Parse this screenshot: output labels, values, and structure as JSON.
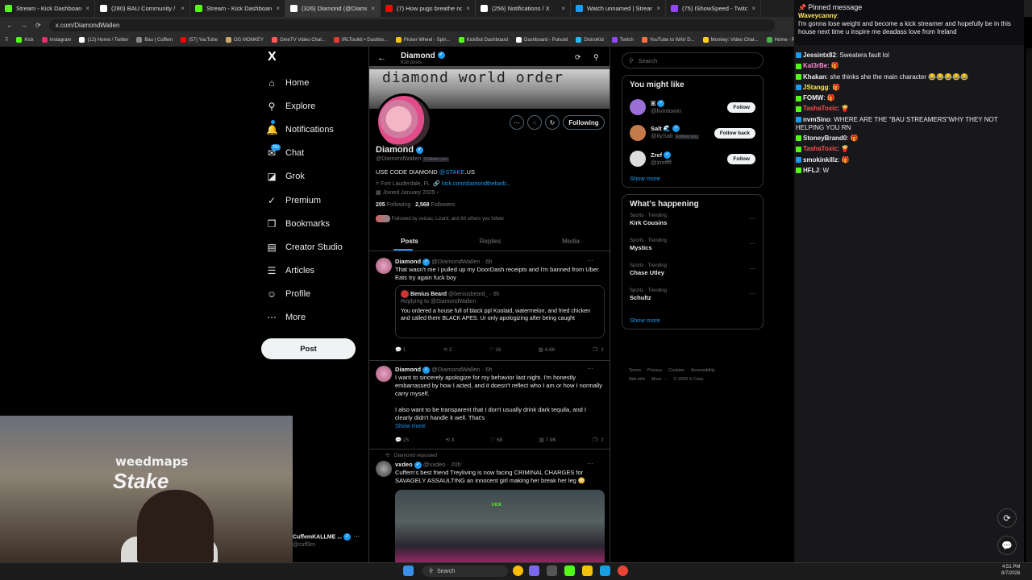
{
  "tabs": [
    {
      "title": "Stream - Kick Dashboard",
      "color": "#53fc18"
    },
    {
      "title": "(280) BAU Community / X",
      "color": "#ffffff"
    },
    {
      "title": "Stream - Kick Dashboard",
      "color": "#53fc18"
    },
    {
      "title": "(326) Diamond (@DiamondWa…",
      "color": "#ffffff"
    },
    {
      "title": "(7) How pugs breathe normally…",
      "color": "#ff0000"
    },
    {
      "title": "(256) Notifications / X",
      "color": "#ffffff"
    },
    {
      "title": "Watch unnamed | Streamable",
      "color": "#1d9bf0"
    },
    {
      "title": "(75) IShowSpeed - Twitch",
      "color": "#9146ff"
    }
  ],
  "address": {
    "url": "x.com/DiamondWallen"
  },
  "bookmarks": [
    {
      "label": "Kick",
      "color": "#53fc18"
    },
    {
      "label": "Instagram",
      "color": "#e1306c"
    },
    {
      "label": "(12) Home / Twitter",
      "color": "#ffffff"
    },
    {
      "label": "Bau | Cuffem",
      "color": "#888888"
    },
    {
      "label": "(57) YouTube",
      "color": "#ff0000"
    },
    {
      "label": "OG MONKEY",
      "color": "#c9a86a"
    },
    {
      "label": "OmeTV Video Chat...",
      "color": "#ff5a5a"
    },
    {
      "label": "IRLToolkit • Dashbo...",
      "color": "#e53935"
    },
    {
      "label": "Picker Wheel - Spin...",
      "color": "#f4c20d"
    },
    {
      "label": "KickBot Dashboard",
      "color": "#53fc18"
    },
    {
      "label": "Dashboard - Pulsoid",
      "color": "#ffffff"
    },
    {
      "label": "DistroKid",
      "color": "#29b6f6"
    },
    {
      "label": "Twitch",
      "color": "#9146ff"
    },
    {
      "label": "YouTube to WAV D...",
      "color": "#ff7043"
    },
    {
      "label": "Monkey: Video Chat...",
      "color": "#ffca28"
    },
    {
      "label": "Home - Rob",
      "color": "#4caf50"
    }
  ],
  "nav": {
    "logo": "X",
    "items": [
      {
        "label": "Home",
        "icon": "⌂"
      },
      {
        "label": "Explore",
        "icon": "⚲"
      },
      {
        "label": "Notifications",
        "icon": "🔔"
      },
      {
        "label": "Chat",
        "icon": "✉"
      },
      {
        "label": "Grok",
        "icon": "◪"
      },
      {
        "label": "Premium",
        "icon": "✓"
      },
      {
        "label": "Bookmarks",
        "icon": "❒"
      },
      {
        "label": "Creator Studio",
        "icon": "▤"
      },
      {
        "label": "Articles",
        "icon": "☰"
      },
      {
        "label": "Profile",
        "icon": "☺"
      },
      {
        "label": "More",
        "icon": "⋯"
      }
    ],
    "chat_badge": "20+",
    "post_label": "Post"
  },
  "profile": {
    "header_name": "Diamond",
    "header_posts": "918 posts",
    "banner_text": "diamond world order",
    "name": "Diamond",
    "handle": "@DiamondWallen",
    "follows_you": "Follows you",
    "bio_prefix": "USE CODE DIAMOND",
    "bio_link": "@STAKE",
    "bio_suffix": ".US",
    "location": "Fort Lauderdale, FL",
    "website": "kick.com/diamondthebarb...",
    "joined": "Joined January 2025",
    "following_count": "205",
    "following_label": "Following",
    "followers_count": "2,568",
    "followers_label": "Followers",
    "followed_by": "Followed by veizau, Lizard, and 60 others you follow",
    "following_btn": "Following"
  },
  "profile_tabs": [
    "Posts",
    "Replies",
    "Media"
  ],
  "tweets": [
    {
      "name": "Diamond",
      "handle": "@DiamondWallen · 6h",
      "text": "That wasn't me I pulled up my DoorDash receipts and I'm banned from Uber Eats try again fuck boy",
      "quote": {
        "name": "Benius Beard",
        "handle": "@beniusbeard_ · 6h",
        "replying": "Replying to @DiamondWallen",
        "text": "You ordered a house full of black ppl Koolaid, watermelon, and fried chicken and called them BLACK APES. Ur only apologizing after being caught"
      },
      "replies": "1",
      "reposts": "2",
      "likes": "16",
      "views": "4.6K"
    },
    {
      "name": "Diamond",
      "handle": "@DiamondWallen · 6h",
      "text": "I want to sincerely apologize for my behavior last night. I'm honestly embarrassed by how I acted, and it doesn't reflect who I am or how I normally carry myself.",
      "text2": "I also want to be transparent that I don't usually drink dark tequila, and I clearly didn't handle it well. That's",
      "show_more": "Show more",
      "replies": "25",
      "reposts": "3",
      "likes": "68",
      "views": "7.9K"
    },
    {
      "repost_label": "Diamond reposted",
      "name": "vxdeo",
      "handle": "@vxdeo · 20h",
      "text": "Cuffem's best friend Treyliving is now facing CRIMINAL CHARGES for SAVAGELY ASSAULTING an innocent girl making her break her leg 😳",
      "media_tag": "KICK"
    }
  ],
  "right": {
    "search_placeholder": "Search",
    "might_like_title": "You might like",
    "suggestions": [
      {
        "name": "ꕤ",
        "handle": "@livintowin",
        "button": "Follow",
        "color": "#9b6fd6"
      },
      {
        "name": "Salt 🌊",
        "handle": "@ilySalt",
        "follows_you": "Follows you",
        "button": "Follow back",
        "color": "#c47a4a"
      },
      {
        "name": "Zref",
        "handle": "@zreffff",
        "button": "Follow",
        "color": "#dddddd"
      }
    ],
    "show_more": "Show more",
    "happening_title": "What's happening",
    "trends": [
      {
        "context": "Sports · Trending",
        "topic": "Kirk Cousins"
      },
      {
        "context": "Sports · Trending",
        "topic": "Mystics"
      },
      {
        "context": "Sports · Trending",
        "topic": "Chase Utley"
      },
      {
        "context": "Sports · Trending",
        "topic": "Schultz"
      }
    ],
    "footer": [
      "Terms",
      "Privacy",
      "Cookies",
      "Accessibility",
      "Ads info",
      "More ···",
      "© 2026 X Corp."
    ]
  },
  "chat": {
    "pinned_title": "Pinned message",
    "pinned_user": "Waveycanny",
    "pinned_text": "I'm gonna lose weight and become a kick streamer and hopefully be in this house next time u inspire me deadass love from Ireland",
    "messages": [
      {
        "user": "Jessintx82",
        "color": "#efeff1",
        "text": "Sweatera fault lol"
      },
      {
        "user": "Kal3rBe",
        "color": "#ff8ad8",
        "text": "🎁"
      },
      {
        "user": "Khakan",
        "color": "#efeff1",
        "text": "she thinks she the main character 😂😂😂😂😂"
      },
      {
        "user": "JStangg",
        "color": "#ffe95a",
        "text": "🎁"
      },
      {
        "user": "FOMW",
        "color": "#efeff1",
        "text": "🎁"
      },
      {
        "user": "TashaToxic",
        "color": "#ff4f4f",
        "text": "🍟"
      },
      {
        "user": "nvmSino",
        "color": "#efeff1",
        "text": "WHERE ARE THE \"BAU STREAMERS\"WHY THEY NOT HELPING YOU RN"
      },
      {
        "user": "StoneyBrand0",
        "color": "#efeff1",
        "text": "🎁"
      },
      {
        "user": "TashaToxic",
        "color": "#ff4f4f",
        "text": "🍟"
      },
      {
        "user": "smokinkillz",
        "color": "#efeff1",
        "text": "🎁"
      },
      {
        "user": "HFLJ",
        "color": "#efeff1",
        "text": "W"
      }
    ]
  },
  "webcam": {
    "brand1": "weedmaps",
    "brand2": "Stake"
  },
  "bottom_account": {
    "name": "CuffemKALLME ...",
    "handle": "@cuff3m"
  },
  "taskbar": {
    "search": "Search",
    "time": "4:51 PM",
    "date": "8/7/2026"
  }
}
